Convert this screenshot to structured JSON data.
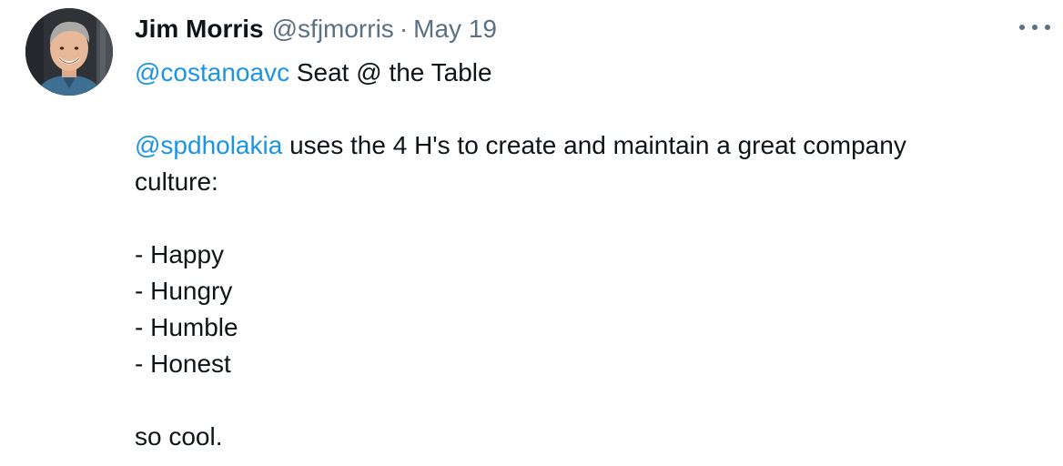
{
  "author": {
    "name": "Jim Morris",
    "handle": "@sfjmorris",
    "separator": "·",
    "date": "May 19"
  },
  "tweet": {
    "mention_1": "@costanoavc",
    "line_1_rest": " Seat @ the Table",
    "mention_2": "@spdholakia",
    "line_2_rest": " uses the 4 H's to create and maintain a great company",
    "line_3": "culture:",
    "list_items": [
      "- Happy",
      "- Hungry",
      "- Humble",
      "- Honest"
    ],
    "closing": "so cool."
  },
  "colors": {
    "link": "#1b95e0",
    "secondary_text": "#5b7083",
    "primary_text": "#0f1419"
  },
  "icons": {
    "more": "more-horizontal-icon"
  }
}
